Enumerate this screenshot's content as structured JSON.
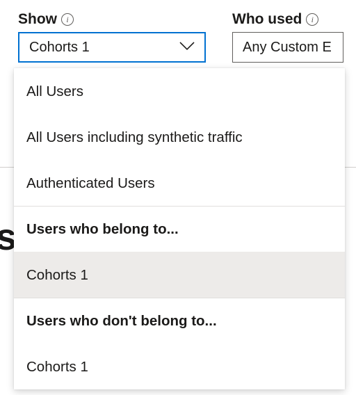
{
  "filters": {
    "show": {
      "label": "Show",
      "selected": "Cohorts 1",
      "options": [
        {
          "label": "All Users",
          "type": "item"
        },
        {
          "label": "All Users including synthetic traffic",
          "type": "item"
        },
        {
          "label": "Authenticated Users",
          "type": "item"
        },
        {
          "label": "Users who belong to...",
          "type": "heading"
        },
        {
          "label": "Cohorts 1",
          "type": "item",
          "selected": true
        },
        {
          "label": "Users who don't belong to...",
          "type": "heading"
        },
        {
          "label": "Cohorts 1",
          "type": "item"
        }
      ]
    },
    "who_used": {
      "label": "Who used",
      "selected": "Any Custom E"
    }
  },
  "bg_letter": "s"
}
